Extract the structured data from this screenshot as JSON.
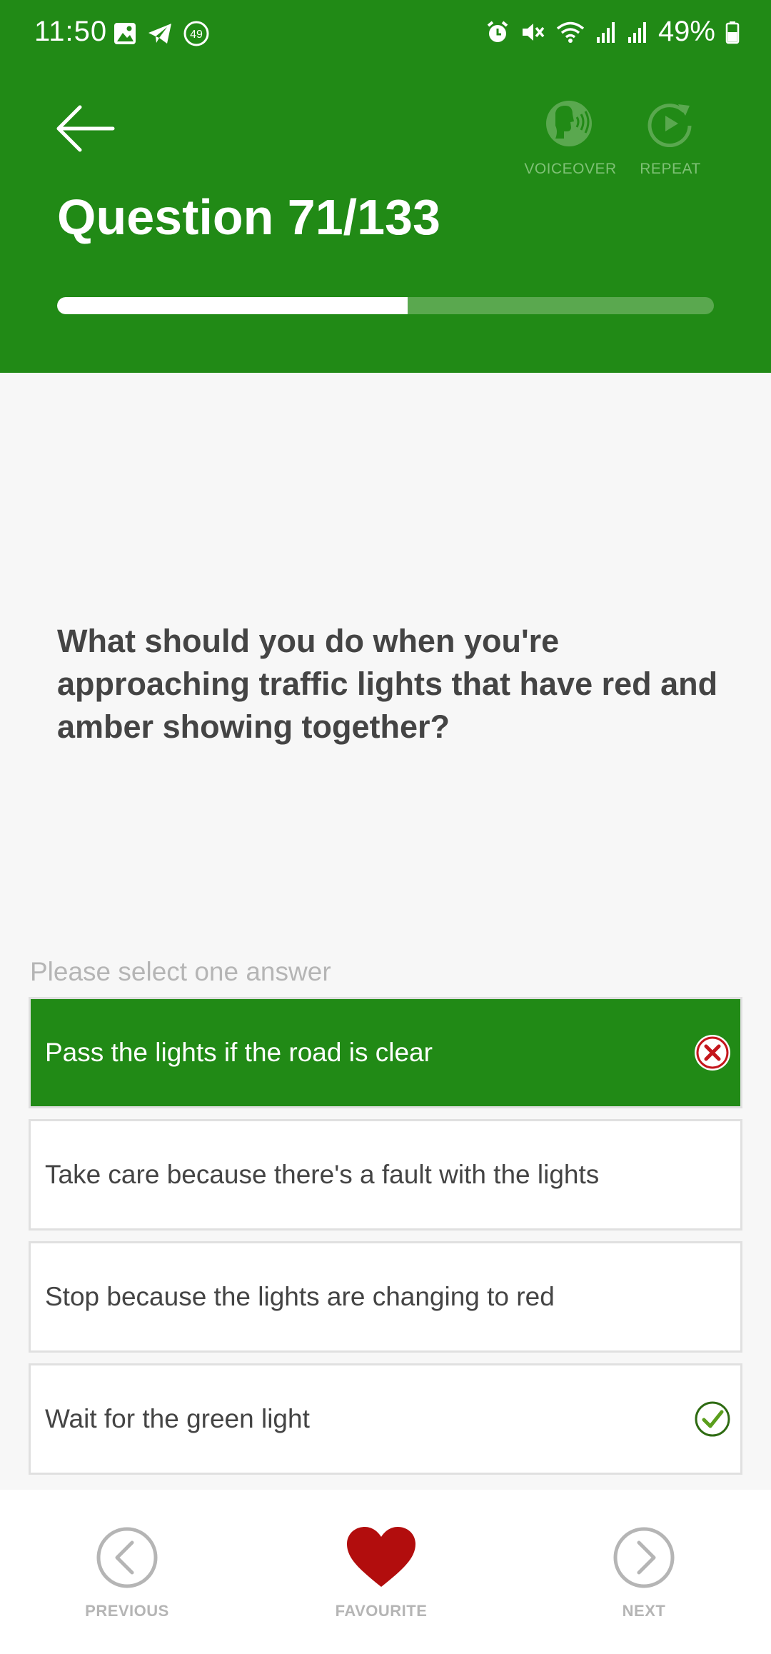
{
  "status_bar": {
    "time": "11:50",
    "notification_badge": "49",
    "battery": "49%",
    "left_icons": [
      "gallery-icon",
      "telegram-icon",
      "badge-49-icon"
    ],
    "right_icons": [
      "alarm-icon",
      "mute-icon",
      "wifi-icon",
      "signal-icon",
      "signal-icon",
      "battery-icon"
    ]
  },
  "header": {
    "title": "Question 71/133",
    "voiceover_label": "VOICEOVER",
    "repeat_label": "REPEAT",
    "progress_fraction": 0.534,
    "color": "#218a16"
  },
  "question": {
    "text": "What should you do when you're approaching traffic lights that have red and amber showing together?",
    "prompt": "Please select one answer"
  },
  "answers": [
    {
      "label": "Pass the lights if the road is clear",
      "selected": true,
      "mark": "wrong"
    },
    {
      "label": "Take care because there's a fault with the lights",
      "selected": false,
      "mark": ""
    },
    {
      "label": "Stop because the lights are changing to red",
      "selected": false,
      "mark": ""
    },
    {
      "label": "Wait for the green light",
      "selected": false,
      "mark": "correct"
    }
  ],
  "bottom_nav": {
    "previous_label": "PREVIOUS",
    "favourite_label": "FAVOURITE",
    "next_label": "NEXT"
  },
  "colors": {
    "brand_green": "#218a16",
    "wrong_red": "#c4161c",
    "favourite_red": "#b20d0d",
    "muted_gray": "#b5b5b5"
  }
}
